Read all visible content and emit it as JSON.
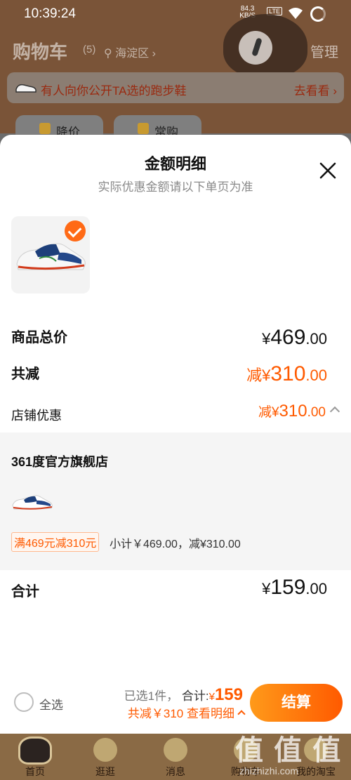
{
  "status_bar": {
    "time": "10:39:24",
    "net_speed": "84.3",
    "net_unit": "KB/S",
    "network": "LTE"
  },
  "cart": {
    "title": "购物车",
    "count": "(5)",
    "location": "海淀区",
    "manage_label": "管理"
  },
  "promo": {
    "text": "有人向你公开TA选的跑步鞋",
    "link": "去看看"
  },
  "filters": {
    "price_drop": "降价",
    "frequent": "常购"
  },
  "sheet": {
    "title": "金额明细",
    "subtitle": "实际优惠金额请以下单页为准",
    "total_label": "商品总价",
    "total_cur": "¥",
    "total_int": "469",
    "total_dec": ".00",
    "discount_label": "共减",
    "discount_prefix": "减¥",
    "discount_int": "310",
    "discount_dec": ".00",
    "store_discount_label": "店铺优惠",
    "store_discount_prefix": "减¥",
    "store_discount_int": "310",
    "store_discount_dec": ".00",
    "store_name": "361度官方旗舰店",
    "promo_tag": "满469元减310元",
    "subtotal_text": "小计￥469.00，减¥310.00",
    "sum_label": "合计",
    "sum_cur": "¥",
    "sum_int": "159",
    "sum_dec": ".00"
  },
  "checkout_bar": {
    "select_all": "全选",
    "selected": "已选1件，",
    "total_label": "合计:",
    "total_cur": "¥",
    "total_value": "159",
    "saved_text": "共减￥310",
    "view_detail": "查看明细",
    "checkout_label": "结算"
  },
  "tabs": [
    {
      "label": "首页"
    },
    {
      "label": "逛逛"
    },
    {
      "label": "消息"
    },
    {
      "label": "购物车"
    },
    {
      "label": "我的淘宝"
    }
  ],
  "watermark": {
    "logo_text": "值 值 值",
    "site": "zhizhizhi.com"
  },
  "colors": {
    "accent": "#ff5a00",
    "checkout_gradient_start": "#ff9a1a",
    "header_bg": "#7a5438"
  }
}
